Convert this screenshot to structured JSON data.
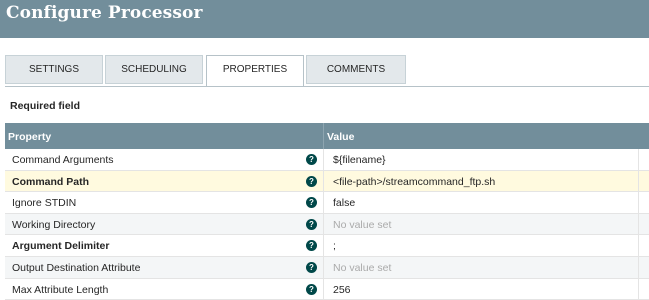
{
  "dialog": {
    "title": "Configure Processor"
  },
  "tabs": [
    {
      "label": "SETTINGS"
    },
    {
      "label": "SCHEDULING"
    },
    {
      "label": "PROPERTIES"
    },
    {
      "label": "COMMENTS"
    }
  ],
  "active_tab": "PROPERTIES",
  "required_note": "Required field",
  "grid": {
    "columns": {
      "property": "Property",
      "value": "Value"
    },
    "rows": [
      {
        "name": "Command Arguments",
        "value": "${filename}",
        "required": false,
        "empty": false
      },
      {
        "name": "Command Path",
        "value": "<file-path>/streamcommand_ftp.sh",
        "required": true,
        "empty": false,
        "selected": true
      },
      {
        "name": "Ignore STDIN",
        "value": "false",
        "required": false,
        "empty": false
      },
      {
        "name": "Working Directory",
        "value": "No value set",
        "required": false,
        "empty": true
      },
      {
        "name": "Argument Delimiter",
        "value": ";",
        "required": true,
        "empty": false
      },
      {
        "name": "Output Destination Attribute",
        "value": "No value set",
        "required": false,
        "empty": true
      },
      {
        "name": "Max Attribute Length",
        "value": "256",
        "required": false,
        "empty": false
      }
    ]
  },
  "icons": {
    "help": "question-circle-icon",
    "help_glyph": "?"
  },
  "colors": {
    "header": "#728e9b",
    "help_icon": "#004849",
    "selected_row": "#fffadf"
  }
}
